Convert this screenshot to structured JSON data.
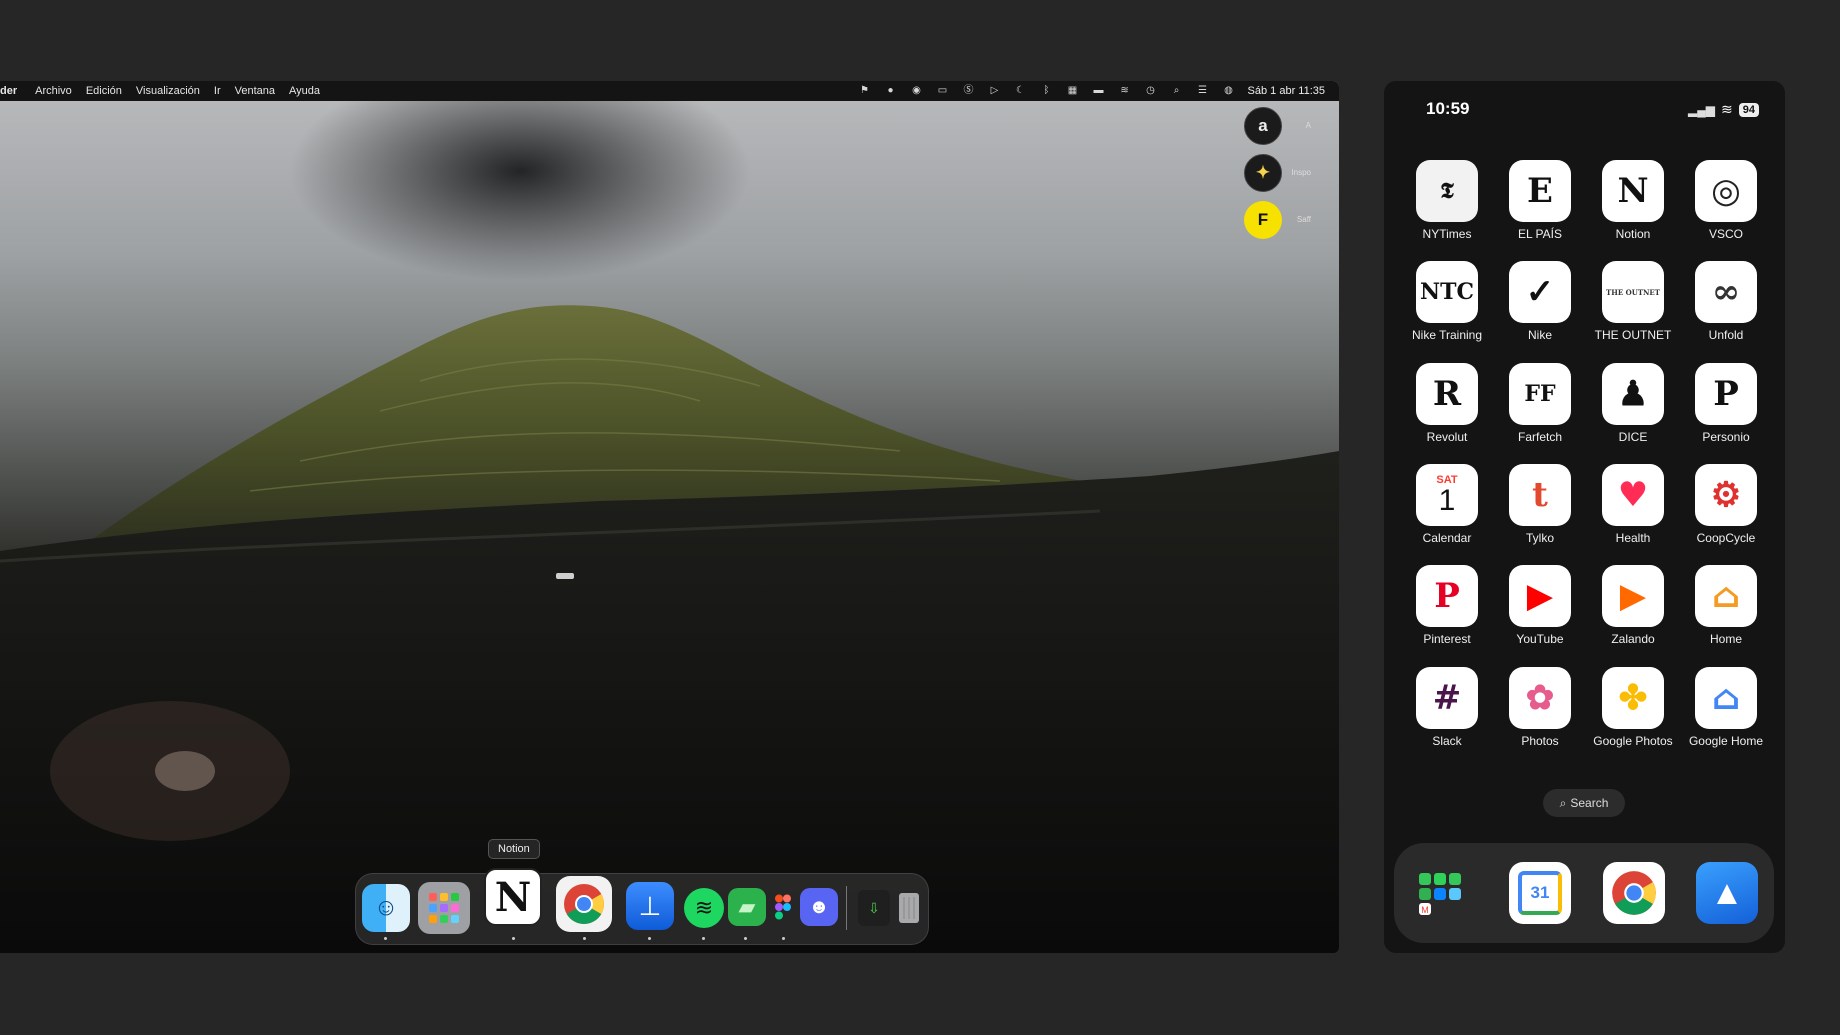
{
  "mac": {
    "menubar": {
      "app_name": "der",
      "items": [
        "Archivo",
        "Edición",
        "Visualización",
        "Ir",
        "Ventana",
        "Ayuda"
      ],
      "clock": "Sáb 1 abr  11:35",
      "status_icons": [
        "fastlane-icon",
        "shield-icon",
        "screen-record-icon",
        "folder-icon",
        "app-store-icon",
        "play-icon",
        "moon-icon",
        "bluetooth-icon",
        "keyboard-icon",
        "battery-icon",
        "wifi-icon",
        "time-machine-icon",
        "search-icon",
        "control-center-icon",
        "siri-icon"
      ]
    },
    "widgets": [
      {
        "name": "arc-widget",
        "glyph": "a",
        "label": "A",
        "bg": "#1b1b1b"
      },
      {
        "name": "inspo-widget",
        "glyph": "✦",
        "label": "Inspo",
        "bg": "#1b1b1b"
      },
      {
        "name": "saff-widget",
        "glyph": "F",
        "label": "Saff",
        "bg": "#f6e100"
      }
    ],
    "dock_tooltip": "Notion",
    "dock": [
      "Finder",
      "Launchpad",
      "Notion",
      "Google Chrome",
      "Keynote",
      "Spotify",
      "Messages",
      "Figma",
      "Discord",
      "Downloads",
      "Trash"
    ]
  },
  "phone": {
    "time": "10:59",
    "battery": "94",
    "apps": [
      {
        "label": "NYTimes",
        "glyph": "𝕿",
        "bg": "#f2f2f2",
        "fg": "#111"
      },
      {
        "label": "EL PAÍS",
        "glyph": "E",
        "bg": "#ffffff",
        "fg": "#111"
      },
      {
        "label": "Notion",
        "glyph": "N",
        "bg": "#ffffff",
        "fg": "#111"
      },
      {
        "label": "VSCO",
        "glyph": "◎",
        "bg": "#ffffff",
        "fg": "#222"
      },
      {
        "label": "Nike Training",
        "glyph": "NTC",
        "bg": "#ffffff",
        "fg": "#111"
      },
      {
        "label": "Nike",
        "glyph": "✓",
        "bg": "#ffffff",
        "fg": "#111"
      },
      {
        "label": "THE OUTNET",
        "glyph": "THE OUTNET",
        "bg": "#ffffff",
        "fg": "#333"
      },
      {
        "label": "Unfold",
        "glyph": "∞",
        "bg": "#ffffff",
        "fg": "#333"
      },
      {
        "label": "Revolut",
        "glyph": "R",
        "bg": "#ffffff",
        "fg": "#111"
      },
      {
        "label": "Farfetch",
        "glyph": "FF",
        "bg": "#ffffff",
        "fg": "#111"
      },
      {
        "label": "DICE",
        "glyph": "♟",
        "bg": "#ffffff",
        "fg": "#111"
      },
      {
        "label": "Personio",
        "glyph": "P",
        "bg": "#ffffff",
        "fg": "#111"
      },
      {
        "label": "Calendar",
        "glyph": "1",
        "bg": "#ffffff",
        "fg": "#111"
      },
      {
        "label": "Tylko",
        "glyph": "t",
        "bg": "#ffffff",
        "fg": "#e2492f"
      },
      {
        "label": "Health",
        "glyph": "♥",
        "bg": "#ffffff",
        "fg": "#ff2d55"
      },
      {
        "label": "CoopCycle",
        "glyph": "⚙",
        "bg": "#ffffff",
        "fg": "#e03131"
      },
      {
        "label": "Pinterest",
        "glyph": "P",
        "bg": "#ffffff",
        "fg": "#e60023"
      },
      {
        "label": "YouTube",
        "glyph": "▶",
        "bg": "#ffffff",
        "fg": "#ff0000"
      },
      {
        "label": "Zalando",
        "glyph": "▶",
        "bg": "#ffffff",
        "fg": "#ff6900"
      },
      {
        "label": "Home",
        "glyph": "⌂",
        "bg": "#ffffff",
        "fg": "#f59a23"
      },
      {
        "label": "Slack",
        "glyph": "#",
        "bg": "#ffffff",
        "fg": "#4a154b"
      },
      {
        "label": "Photos",
        "glyph": "✿",
        "bg": "#ffffff",
        "fg": "#e65c8c"
      },
      {
        "label": "Google Photos",
        "glyph": "✤",
        "bg": "#ffffff",
        "fg": "#fbbc05"
      },
      {
        "label": "Google Home",
        "glyph": "⌂",
        "bg": "#ffffff",
        "fg": "#4285f4"
      }
    ],
    "calendar_day": "SAT",
    "search_label": "Search",
    "dock": [
      "Utilities Folder",
      "Google Calendar",
      "Google Chrome",
      "Spark"
    ],
    "gcal_day": "31"
  }
}
